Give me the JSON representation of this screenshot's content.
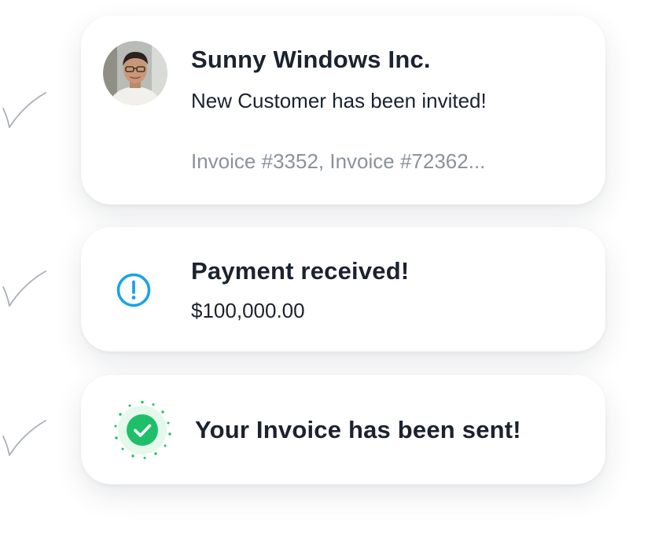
{
  "notifications": [
    {
      "title": "Sunny Windows Inc.",
      "message": "New Customer has been invited!",
      "detail": "Invoice #3352, Invoice #72362...",
      "icon": "avatar"
    },
    {
      "title": "Payment received!",
      "amount": "$100,000.00",
      "icon": "exclamation-circle-icon"
    },
    {
      "title": "Your Invoice has been sent!",
      "icon": "check-circle-icon"
    }
  ],
  "colors": {
    "title_text": "#1b2230",
    "muted_text": "#8a929c",
    "info_blue": "#1aa3e8",
    "success_green": "#1fbf6a",
    "check_mark_gray": "#a9afb9"
  }
}
